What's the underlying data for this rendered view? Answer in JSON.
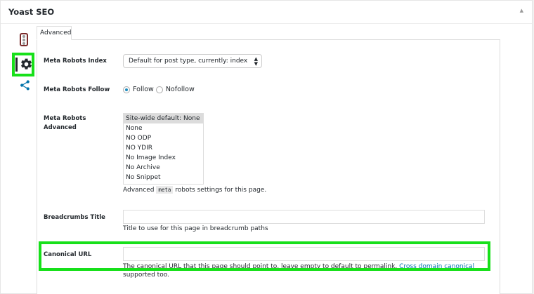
{
  "metabox": {
    "title": "Yoast SEO",
    "toggle_glyph": "▲"
  },
  "side_icons": [
    "traffic-light-icon",
    "gear-icon",
    "share-icon"
  ],
  "tab": {
    "label": "Advanced"
  },
  "fields": {
    "robots_index": {
      "label": "Meta Robots Index",
      "value": "Default for post type, currently: index",
      "arrows": "▲\n▼"
    },
    "robots_follow": {
      "label": "Meta Robots Follow",
      "options": [
        "Follow",
        "Nofollow"
      ],
      "selected": "Follow"
    },
    "robots_advanced": {
      "label": "Meta Robots Advanced",
      "options": [
        "Site-wide default: None",
        "None",
        "NO ODP",
        "NO YDIR",
        "No Image Index",
        "No Archive",
        "No Snippet"
      ],
      "selected": "Site-wide default: None",
      "desc_prefix": "Advanced",
      "desc_code": "meta",
      "desc_suffix": "robots settings for this page."
    },
    "breadcrumbs_title": {
      "label": "Breadcrumbs Title",
      "value": "",
      "desc": "Title to use for this page in breadcrumb paths"
    },
    "canonical_url": {
      "label": "Canonical URL",
      "value": "",
      "desc": "The canonical URL that this page should point to, leave empty to default to permalink.",
      "link": "Cross domain canonical",
      "desc_line2": "supported too."
    }
  },
  "colors": {
    "highlight": "#17e01a",
    "link": "#0073aa",
    "radio": "#1e8cbe"
  }
}
